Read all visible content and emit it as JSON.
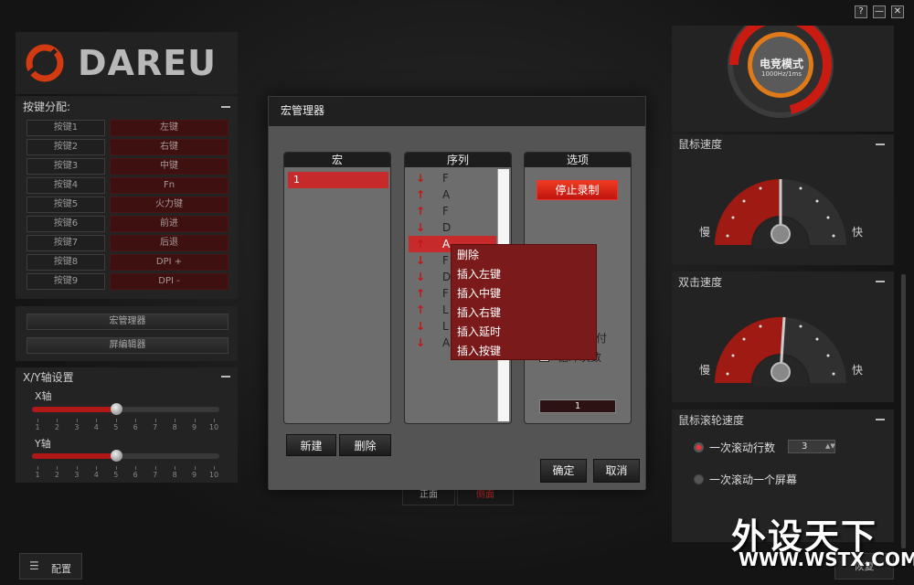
{
  "window": {
    "help": "?",
    "minimize": "—",
    "close": "✕"
  },
  "brand": {
    "logo": "DAREU"
  },
  "keys": {
    "title": "按键分配:",
    "rows": [
      {
        "name": "按键1",
        "value": "左键"
      },
      {
        "name": "按键2",
        "value": "右键"
      },
      {
        "name": "按键3",
        "value": "中键"
      },
      {
        "name": "按键4",
        "value": "Fn"
      },
      {
        "name": "按键5",
        "value": "火力键"
      },
      {
        "name": "按键6",
        "value": "前进"
      },
      {
        "name": "按键7",
        "value": "后退"
      },
      {
        "name": "按键8",
        "value": "DPI +"
      },
      {
        "name": "按键9",
        "value": "DPI -"
      }
    ]
  },
  "tools": {
    "macro_manager": "宏管理器",
    "screen_editor": "屏编辑器"
  },
  "axis": {
    "title": "X/Y轴设置",
    "x_label": "X轴",
    "y_label": "Y轴",
    "x_value": 5,
    "y_value": 5,
    "ticks": [
      "1",
      "2",
      "3",
      "4",
      "5",
      "6",
      "7",
      "8",
      "9",
      "10"
    ]
  },
  "mode": {
    "title": "电竞模式",
    "sub": "1000Hz/1ms"
  },
  "mouse_speed": {
    "title": "鼠标速度",
    "slow": "慢",
    "fast": "快"
  },
  "dbl_speed": {
    "title": "双击速度",
    "slow": "慢",
    "fast": "快"
  },
  "wheel": {
    "title": "鼠标滚轮速度",
    "option1": "一次滚动行数",
    "option1_value": "3",
    "option2": "一次滚动一个屏幕"
  },
  "bottom": {
    "config": "配置",
    "front": "正面",
    "side": "侧面",
    "restore": "恢复"
  },
  "dialog": {
    "title": "宏管理器",
    "col_macro": "宏",
    "col_sequence": "序列",
    "col_options": "选项",
    "macro_items": [
      "1"
    ],
    "sequence": [
      {
        "dir": "down",
        "key": "F"
      },
      {
        "dir": "up",
        "key": "A"
      },
      {
        "dir": "up",
        "key": "F"
      },
      {
        "dir": "down",
        "key": "D"
      },
      {
        "dir": "up",
        "key": "A"
      },
      {
        "dir": "down",
        "key": "F"
      },
      {
        "dir": "down",
        "key": "D"
      },
      {
        "dir": "up",
        "key": "F"
      },
      {
        "dir": "up",
        "key": "L"
      },
      {
        "dir": "down",
        "key": "L"
      },
      {
        "dir": "down",
        "key": "A"
      }
    ],
    "stop_record": "停止录制",
    "partial_text_1": "付",
    "partial_text_2": "循环次数",
    "loop_count": "1",
    "new": "新建",
    "delete": "删除",
    "ok": "确定",
    "cancel": "取消"
  },
  "context_menu": {
    "items": [
      "删除",
      "插入左键",
      "插入中键",
      "插入右键",
      "插入延时",
      "插入按键"
    ]
  },
  "watermark": {
    "main": "外设天下",
    "url": "WWW.WSTX.COM"
  }
}
